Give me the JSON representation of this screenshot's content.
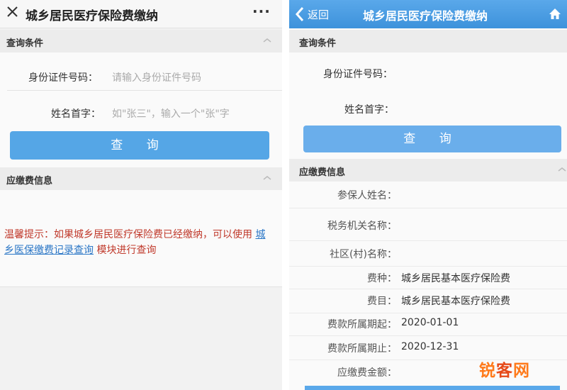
{
  "left": {
    "title": "城乡居民医疗保险费缴纳",
    "more_label": "···",
    "query_section": "查询条件",
    "id_label": "身份证件号码：",
    "id_placeholder": "请输入身份证件号码",
    "name_label": "姓名首字：",
    "name_placeholder": "如\"张三\"，输入一个\"张\"字",
    "query_button": "查 询",
    "payment_section": "应缴费信息",
    "tip_prefix": "温馨提示：如果城乡居民医疗保险费已经缴纳，可以使用",
    "tip_link": "城乡医保缴费记录查询",
    "tip_suffix": "模块进行查询"
  },
  "right": {
    "back_label": "返回",
    "title": "城乡居民医疗保险费缴纳",
    "query_section": "查询条件",
    "id_label": "身份证件号码：",
    "name_label": "姓名首字：",
    "query_button": "查 询",
    "payment_section": "应缴费信息",
    "info_rows": [
      {
        "label": "参保人姓名：",
        "value": ""
      },
      {
        "label": "税务机关名称：",
        "value": ""
      },
      {
        "label": "社区(村)名称：",
        "value": ""
      },
      {
        "label": "费种：",
        "value": "城乡居民基本医疗保险费"
      },
      {
        "label": "费目：",
        "value": "城乡居民基本医疗保险费"
      },
      {
        "label": "费款所属期起：",
        "value": "2020-01-01"
      },
      {
        "label": "费款所属期止：",
        "value": "2020-12-31"
      },
      {
        "label": "应缴费金额：",
        "value": ""
      }
    ]
  },
  "watermark": {
    "part1": "锐",
    "part2": "客",
    "part3": "网"
  },
  "colors": {
    "header_blue": "#4a9be0",
    "button_blue": "#55a6e6",
    "tip_red": "#c0392b",
    "link_blue": "#2a76c6",
    "watermark_orange": "#ff7a1a"
  }
}
